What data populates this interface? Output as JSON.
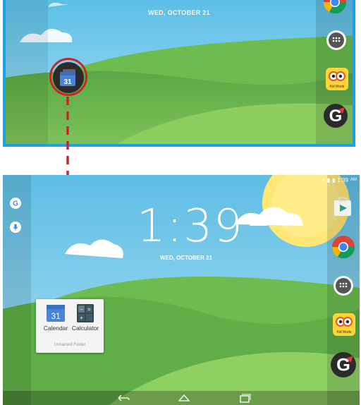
{
  "top_screen": {
    "date": "WED, OCTOBER 21",
    "folder_calendar_day": "31",
    "dock_icons": [
      "chrome-icon",
      "app-drawer-icon",
      "kid-mode-icon",
      "google-play-games-icon"
    ],
    "kid_mode_label": "Kid Mode"
  },
  "bottom_screen": {
    "status": {
      "time": "1:39",
      "ampm": "AM"
    },
    "clock": "1:39",
    "date": "WED, OCTOBER 21",
    "side_icons": [
      "google-icon",
      "mic-icon"
    ],
    "folder": {
      "apps": [
        {
          "label": "Calendar",
          "icon": "calendar-icon",
          "day": "31"
        },
        {
          "label": "Calculator",
          "icon": "calculator-icon"
        }
      ],
      "name": "Unnamed Folder"
    },
    "dock_icons": [
      "play-store-icon",
      "chrome-icon",
      "app-drawer-icon",
      "kid-mode-icon",
      "google-play-games-icon"
    ],
    "kid_mode_label": "Kid Mode",
    "nav_buttons": [
      "back-icon",
      "home-icon",
      "recents-icon"
    ]
  },
  "colors": {
    "highlight_border": "#1aa3e0",
    "annotation_red": "#c9262a",
    "sky": "#8ed2ee",
    "hill": "#6ab74e",
    "sun": "#ffe777"
  }
}
